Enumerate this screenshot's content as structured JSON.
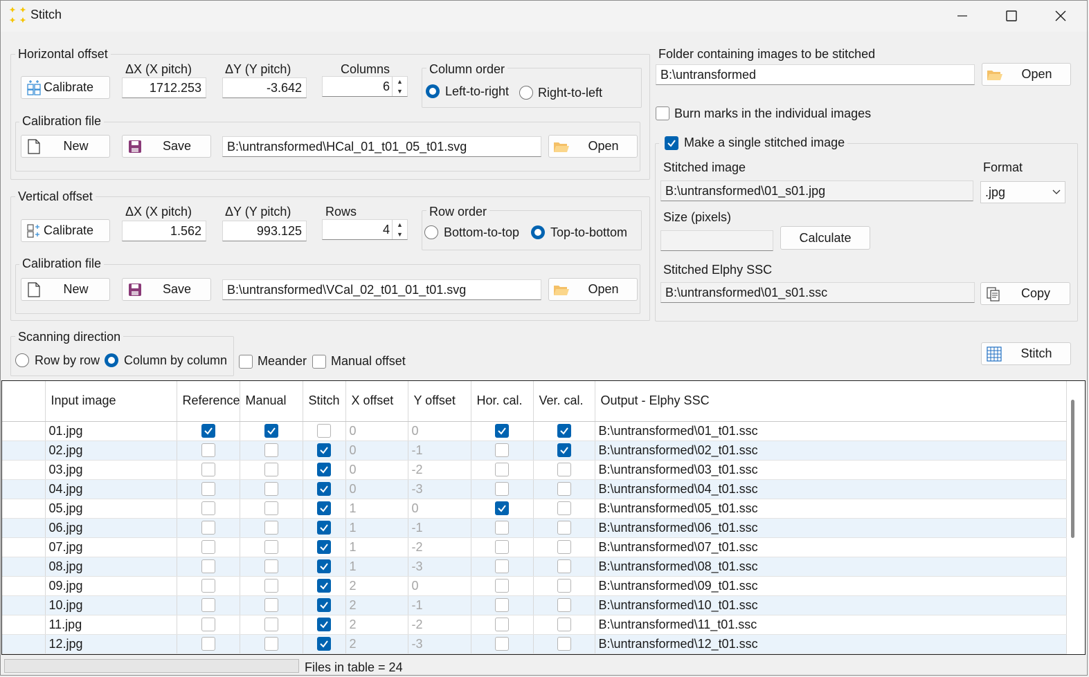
{
  "window": {
    "title": "Stitch"
  },
  "horizontal": {
    "group_label": "Horizontal offset",
    "calibrate_label": "Calibrate",
    "dx_label": "ΔX (X pitch)",
    "dx_value": "1712.253",
    "dy_label": "ΔY (Y pitch)",
    "dy_value": "-3.642",
    "count_label": "Columns",
    "count_value": "6",
    "order_label": "Column order",
    "order_options": [
      "Left-to-right",
      "Right-to-left"
    ],
    "order_selected": "Left-to-right",
    "calfile_label": "Calibration file",
    "new_label": "New",
    "save_label": "Save",
    "calfile_path": "B:\\untransformed\\HCal_01_t01_05_t01.svg",
    "open_label": "Open"
  },
  "vertical": {
    "group_label": "Vertical offset",
    "calibrate_label": "Calibrate",
    "dx_label": "ΔX (X pitch)",
    "dx_value": "1.562",
    "dy_label": "ΔY (Y pitch)",
    "dy_value": "993.125",
    "count_label": "Rows",
    "count_value": "4",
    "order_label": "Row order",
    "order_options": [
      "Bottom-to-top",
      "Top-to-bottom"
    ],
    "order_selected": "Top-to-bottom",
    "calfile_label": "Calibration file",
    "new_label": "New",
    "save_label": "Save",
    "calfile_path": "B:\\untransformed\\VCal_02_t01_01_t01.svg",
    "open_label": "Open"
  },
  "scanning": {
    "label": "Scanning direction",
    "options": [
      "Row by row",
      "Column by column"
    ],
    "selected": "Column by column",
    "meander_label": "Meander",
    "meander_checked": false,
    "manual_offset_label": "Manual offset",
    "manual_offset_checked": false
  },
  "right": {
    "folder_label": "Folder containing images to be stitched",
    "folder_path": "B:\\untransformed",
    "open_label": "Open",
    "burn_label": "Burn marks in the individual images",
    "burn_checked": false,
    "single_label": "Make a single stitched image",
    "single_checked": true,
    "stitched_image_label": "Stitched image",
    "stitched_image_path": "B:\\untransformed\\01_s01.jpg",
    "format_label": "Format",
    "format_value": ".jpg",
    "size_label": "Size (pixels)",
    "size_value": "",
    "calculate_label": "Calculate",
    "ssc_label": "Stitched Elphy SSC",
    "ssc_path": "B:\\untransformed\\01_s01.ssc",
    "copy_label": "Copy",
    "stitch_label": "Stitch"
  },
  "table": {
    "columns": [
      "",
      "Input image",
      "Reference",
      "Manual",
      "Stitch",
      "X offset",
      "Y offset",
      "Hor. cal.",
      "Ver. cal.",
      "Output - Elphy SSC"
    ],
    "rows": [
      {
        "image": "01.jpg",
        "reference": true,
        "manual": true,
        "stitch": false,
        "x": "0",
        "y": "0",
        "hor": true,
        "ver": true,
        "output": "B:\\untransformed\\01_t01.ssc"
      },
      {
        "image": "02.jpg",
        "reference": false,
        "manual": false,
        "stitch": true,
        "x": "0",
        "y": "-1",
        "hor": false,
        "ver": true,
        "output": "B:\\untransformed\\02_t01.ssc"
      },
      {
        "image": "03.jpg",
        "reference": false,
        "manual": false,
        "stitch": true,
        "x": "0",
        "y": "-2",
        "hor": false,
        "ver": false,
        "output": "B:\\untransformed\\03_t01.ssc"
      },
      {
        "image": "04.jpg",
        "reference": false,
        "manual": false,
        "stitch": true,
        "x": "0",
        "y": "-3",
        "hor": false,
        "ver": false,
        "output": "B:\\untransformed\\04_t01.ssc"
      },
      {
        "image": "05.jpg",
        "reference": false,
        "manual": false,
        "stitch": true,
        "x": "1",
        "y": "0",
        "hor": true,
        "ver": false,
        "output": "B:\\untransformed\\05_t01.ssc"
      },
      {
        "image": "06.jpg",
        "reference": false,
        "manual": false,
        "stitch": true,
        "x": "1",
        "y": "-1",
        "hor": false,
        "ver": false,
        "output": "B:\\untransformed\\06_t01.ssc"
      },
      {
        "image": "07.jpg",
        "reference": false,
        "manual": false,
        "stitch": true,
        "x": "1",
        "y": "-2",
        "hor": false,
        "ver": false,
        "output": "B:\\untransformed\\07_t01.ssc"
      },
      {
        "image": "08.jpg",
        "reference": false,
        "manual": false,
        "stitch": true,
        "x": "1",
        "y": "-3",
        "hor": false,
        "ver": false,
        "output": "B:\\untransformed\\08_t01.ssc"
      },
      {
        "image": "09.jpg",
        "reference": false,
        "manual": false,
        "stitch": true,
        "x": "2",
        "y": "0",
        "hor": false,
        "ver": false,
        "output": "B:\\untransformed\\09_t01.ssc"
      },
      {
        "image": "10.jpg",
        "reference": false,
        "manual": false,
        "stitch": true,
        "x": "2",
        "y": "-1",
        "hor": false,
        "ver": false,
        "output": "B:\\untransformed\\10_t01.ssc"
      },
      {
        "image": "11.jpg",
        "reference": false,
        "manual": false,
        "stitch": true,
        "x": "2",
        "y": "-2",
        "hor": false,
        "ver": false,
        "output": "B:\\untransformed\\11_t01.ssc"
      },
      {
        "image": "12.jpg",
        "reference": false,
        "manual": false,
        "stitch": true,
        "x": "2",
        "y": "-3",
        "hor": false,
        "ver": false,
        "output": "B:\\untransformed\\12_t01.ssc"
      }
    ]
  },
  "status": {
    "text": "Files in table = 24"
  }
}
